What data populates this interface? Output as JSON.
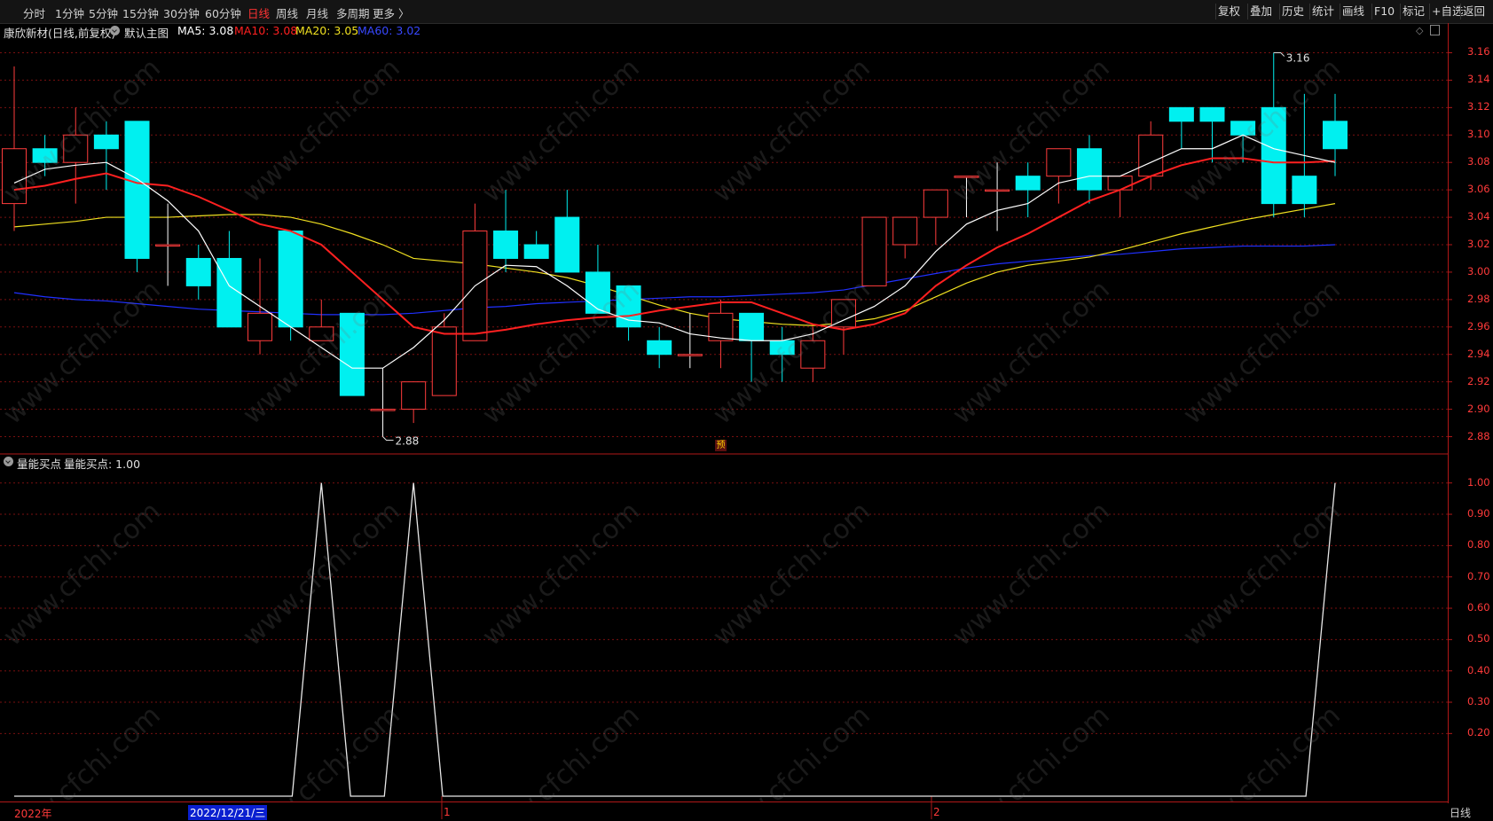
{
  "toolbar": {
    "periods": [
      "分时",
      "1分钟",
      "5分钟",
      "15分钟",
      "30分钟",
      "60分钟",
      "日线",
      "周线",
      "月线",
      "多周期",
      "更多 〉"
    ],
    "active_period": "日线",
    "tools": [
      "复权",
      "叠加",
      "历史",
      "统计",
      "画线",
      "F10",
      "标记",
      "+自选",
      "返回"
    ]
  },
  "main_panel": {
    "stock_title": "康欣新材(日线,前复权)",
    "indicator_name": "默认主图",
    "ma5": {
      "label": "MA5: 3.08",
      "color": "#ffffff"
    },
    "ma10": {
      "label": "MA10: 3.08",
      "color": "#ff2020"
    },
    "ma20": {
      "label": "MA20: 3.05",
      "color": "#f0e020"
    },
    "ma60": {
      "label": "MA60: 3.02",
      "color": "#2030ff"
    },
    "high_marker": "3.16",
    "low_marker": "2.88",
    "pre_badge": "预"
  },
  "sub_panel": {
    "indicator_name": "量能买点",
    "value_label": "量能买点: 1.00"
  },
  "axis": {
    "price_ticks": [
      "3.16",
      "3.14",
      "3.12",
      "3.10",
      "3.08",
      "3.06",
      "3.04",
      "3.02",
      "3.00",
      "2.98",
      "2.96",
      "2.94",
      "2.92",
      "2.90",
      "2.88"
    ],
    "indicator_ticks": [
      "1.00",
      "0.90",
      "0.80",
      "0.70",
      "0.60",
      "0.50",
      "0.40",
      "0.30",
      "0.20"
    ],
    "dates": [
      "2022年",
      "1",
      "2"
    ],
    "cursor_date": "2022/12/21/三",
    "period_corner": "日线"
  },
  "colors": {
    "up": "#ff3c3c",
    "down": "#00f0f0",
    "axis": "#b01818",
    "grid": "#7a1010",
    "background": "#000000"
  },
  "watermark": "www.cfchi.com",
  "chart_data": {
    "type": "candlestick",
    "price_range": [
      2.87,
      3.17
    ],
    "candles": [
      {
        "o": 3.05,
        "h": 3.15,
        "l": 3.03,
        "c": 3.09
      },
      {
        "o": 3.09,
        "h": 3.1,
        "l": 3.07,
        "c": 3.08
      },
      {
        "o": 3.08,
        "h": 3.12,
        "l": 3.05,
        "c": 3.1
      },
      {
        "o": 3.1,
        "h": 3.11,
        "l": 3.06,
        "c": 3.09
      },
      {
        "o": 3.11,
        "h": 3.11,
        "l": 3.0,
        "c": 3.01
      },
      {
        "o": 3.02,
        "h": 3.05,
        "l": 2.99,
        "c": 3.02
      },
      {
        "o": 3.01,
        "h": 3.02,
        "l": 2.98,
        "c": 2.99
      },
      {
        "o": 3.01,
        "h": 3.03,
        "l": 2.96,
        "c": 2.96
      },
      {
        "o": 2.95,
        "h": 3.01,
        "l": 2.94,
        "c": 2.97
      },
      {
        "o": 3.03,
        "h": 3.03,
        "l": 2.95,
        "c": 2.96
      },
      {
        "o": 2.95,
        "h": 2.98,
        "l": 2.95,
        "c": 2.96
      },
      {
        "o": 2.97,
        "h": 2.97,
        "l": 2.91,
        "c": 2.91
      },
      {
        "o": 2.9,
        "h": 2.93,
        "l": 2.88,
        "c": 2.9
      },
      {
        "o": 2.9,
        "h": 2.92,
        "l": 2.89,
        "c": 2.92
      },
      {
        "o": 2.91,
        "h": 2.97,
        "l": 2.91,
        "c": 2.96
      },
      {
        "o": 2.95,
        "h": 3.05,
        "l": 2.95,
        "c": 3.03
      },
      {
        "o": 3.03,
        "h": 3.06,
        "l": 3.0,
        "c": 3.01
      },
      {
        "o": 3.02,
        "h": 3.03,
        "l": 3.01,
        "c": 3.01
      },
      {
        "o": 3.04,
        "h": 3.06,
        "l": 3.0,
        "c": 3.0
      },
      {
        "o": 3.0,
        "h": 3.02,
        "l": 2.97,
        "c": 2.97
      },
      {
        "o": 2.99,
        "h": 2.99,
        "l": 2.95,
        "c": 2.96
      },
      {
        "o": 2.95,
        "h": 2.96,
        "l": 2.93,
        "c": 2.94
      },
      {
        "o": 2.94,
        "h": 2.97,
        "l": 2.93,
        "c": 2.94
      },
      {
        "o": 2.95,
        "h": 2.98,
        "l": 2.93,
        "c": 2.97
      },
      {
        "o": 2.97,
        "h": 2.97,
        "l": 2.92,
        "c": 2.95
      },
      {
        "o": 2.95,
        "h": 2.96,
        "l": 2.92,
        "c": 2.94
      },
      {
        "o": 2.93,
        "h": 2.96,
        "l": 2.92,
        "c": 2.95
      },
      {
        "o": 2.96,
        "h": 2.98,
        "l": 2.94,
        "c": 2.98
      },
      {
        "o": 2.99,
        "h": 3.04,
        "l": 2.99,
        "c": 3.04
      },
      {
        "o": 3.02,
        "h": 3.04,
        "l": 3.01,
        "c": 3.04
      },
      {
        "o": 3.04,
        "h": 3.06,
        "l": 3.02,
        "c": 3.06
      },
      {
        "o": 3.07,
        "h": 3.07,
        "l": 3.04,
        "c": 3.07
      },
      {
        "o": 3.06,
        "h": 3.08,
        "l": 3.03,
        "c": 3.06
      },
      {
        "o": 3.07,
        "h": 3.08,
        "l": 3.04,
        "c": 3.06
      },
      {
        "o": 3.07,
        "h": 3.09,
        "l": 3.05,
        "c": 3.09
      },
      {
        "o": 3.09,
        "h": 3.1,
        "l": 3.05,
        "c": 3.06
      },
      {
        "o": 3.06,
        "h": 3.07,
        "l": 3.04,
        "c": 3.07
      },
      {
        "o": 3.07,
        "h": 3.11,
        "l": 3.06,
        "c": 3.1
      },
      {
        "o": 3.12,
        "h": 3.12,
        "l": 3.09,
        "c": 3.11
      },
      {
        "o": 3.12,
        "h": 3.12,
        "l": 3.08,
        "c": 3.11
      },
      {
        "o": 3.11,
        "h": 3.11,
        "l": 3.08,
        "c": 3.1
      },
      {
        "o": 3.12,
        "h": 3.16,
        "l": 3.04,
        "c": 3.05
      },
      {
        "o": 3.07,
        "h": 3.13,
        "l": 3.04,
        "c": 3.05
      },
      {
        "o": 3.11,
        "h": 3.13,
        "l": 3.07,
        "c": 3.09
      }
    ],
    "ma5": [
      3.065,
      3.075,
      3.078,
      3.08,
      3.068,
      3.052,
      3.03,
      2.99,
      2.975,
      2.96,
      2.945,
      2.93,
      2.93,
      2.945,
      2.965,
      2.99,
      3.005,
      3.004,
      2.99,
      2.973,
      2.965,
      2.963,
      2.955,
      2.952,
      2.95,
      2.95,
      2.955,
      2.965,
      2.975,
      2.99,
      3.015,
      3.035,
      3.045,
      3.05,
      3.065,
      3.07,
      3.07,
      3.08,
      3.09,
      3.09,
      3.1,
      3.09,
      3.085,
      3.08
    ],
    "ma10": [
      3.06,
      3.063,
      3.068,
      3.072,
      3.065,
      3.063,
      3.055,
      3.045,
      3.035,
      3.03,
      3.02,
      3.0,
      2.98,
      2.96,
      2.955,
      2.955,
      2.958,
      2.962,
      2.965,
      2.967,
      2.968,
      2.972,
      2.975,
      2.978,
      2.978,
      2.97,
      2.962,
      2.958,
      2.962,
      2.97,
      2.99,
      3.005,
      3.018,
      3.028,
      3.04,
      3.052,
      3.06,
      3.07,
      3.078,
      3.083,
      3.083,
      3.08,
      3.08,
      3.081
    ],
    "ma20": [
      3.033,
      3.035,
      3.037,
      3.04,
      3.04,
      3.04,
      3.041,
      3.042,
      3.042,
      3.04,
      3.035,
      3.028,
      3.02,
      3.01,
      3.008,
      3.006,
      3.003,
      3.0,
      2.996,
      2.99,
      2.983,
      2.976,
      2.97,
      2.966,
      2.964,
      2.962,
      2.961,
      2.963,
      2.966,
      2.972,
      2.982,
      2.992,
      3.0,
      3.005,
      3.008,
      3.011,
      3.016,
      3.022,
      3.028,
      3.033,
      3.038,
      3.042,
      3.046,
      3.05
    ],
    "ma60": [
      2.985,
      2.982,
      2.98,
      2.979,
      2.977,
      2.975,
      2.973,
      2.972,
      2.971,
      2.97,
      2.969,
      2.969,
      2.969,
      2.97,
      2.972,
      2.974,
      2.975,
      2.977,
      2.978,
      2.979,
      2.98,
      2.981,
      2.982,
      2.982,
      2.983,
      2.984,
      2.985,
      2.987,
      2.991,
      2.995,
      2.999,
      3.003,
      3.006,
      3.008,
      3.01,
      3.012,
      3.013,
      3.015,
      3.017,
      3.018,
      3.019,
      3.019,
      3.019,
      3.02
    ],
    "indicator": {
      "name": "量能买点",
      "range": [
        0,
        1
      ],
      "values": [
        0,
        0,
        0,
        0,
        0,
        0,
        0,
        0,
        0,
        0,
        1,
        0,
        0,
        1,
        0,
        0,
        0,
        0,
        0,
        0,
        0,
        0,
        0,
        0,
        0,
        0,
        0,
        0,
        0,
        0,
        0,
        0,
        0,
        0,
        0,
        0,
        0,
        0,
        0,
        0,
        0,
        0,
        0,
        1
      ]
    }
  }
}
